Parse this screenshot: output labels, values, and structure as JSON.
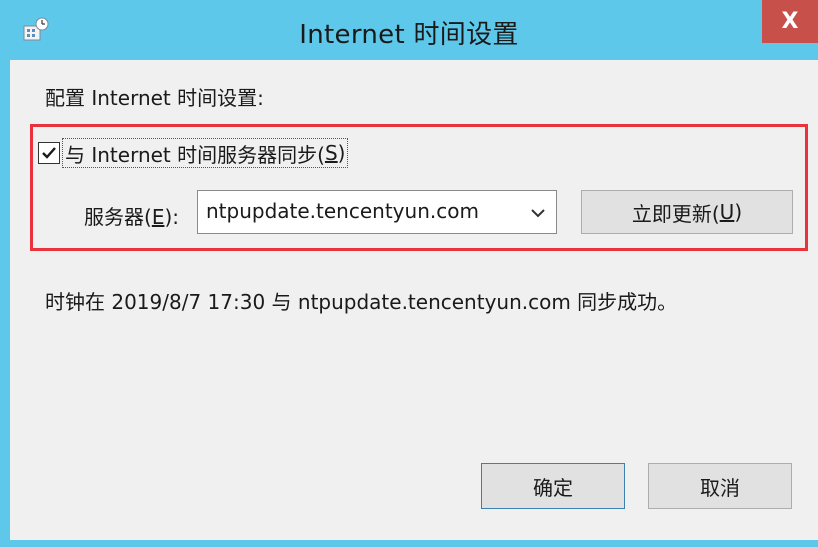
{
  "window": {
    "title": "Internet 时间设置",
    "close_label": "X"
  },
  "config_heading": "配置 Internet 时间设置:",
  "sync": {
    "checked": true,
    "label_prefix": "与 Internet 时间服务器同步(",
    "label_mnemonic": "S",
    "label_suffix": ")"
  },
  "server": {
    "label_prefix": "服务器(",
    "label_mnemonic": "E",
    "label_suffix": "):",
    "value": "ntpupdate.tencentyun.com",
    "update_prefix": "立即更新(",
    "update_mnemonic": "U",
    "update_suffix": ")"
  },
  "status_text": "时钟在 2019/8/7 17:30 与 ntpupdate.tencentyun.com 同步成功。",
  "buttons": {
    "ok": "确定",
    "cancel": "取消"
  },
  "colors": {
    "titlebar": "#5ec8ea",
    "close": "#c7504b",
    "highlight": "#e8323c",
    "client": "#f0f0f0"
  }
}
